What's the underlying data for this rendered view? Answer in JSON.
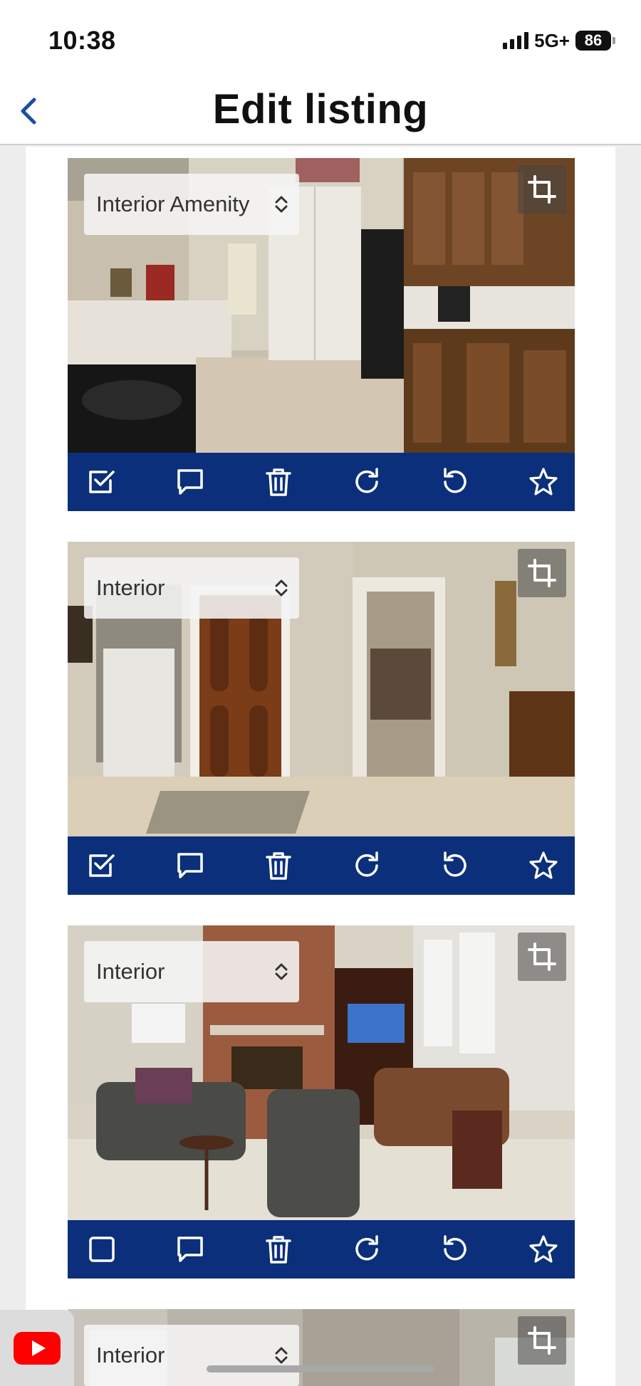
{
  "status_bar": {
    "time": "10:38",
    "network": "5G+",
    "battery": "86"
  },
  "header": {
    "title": "Edit listing",
    "back_icon": "chevron-left-icon"
  },
  "photos": [
    {
      "room_label": "Interior Amenity",
      "scene": "kitchen",
      "selected": true
    },
    {
      "room_label": "Interior",
      "scene": "entry",
      "selected": true
    },
    {
      "room_label": "Interior",
      "scene": "living-room",
      "selected": false
    },
    {
      "room_label": "Interior",
      "scene": "partial",
      "selected": false
    }
  ],
  "toolbar_actions": [
    "select-checkbox",
    "comment",
    "delete",
    "rotate-right",
    "rotate-left",
    "favorite-star"
  ],
  "colors": {
    "toolbar": "#0b2f7a",
    "accent": "#1a4fa0",
    "youtube_red": "#ff0000"
  },
  "floating_app": "youtube-icon"
}
